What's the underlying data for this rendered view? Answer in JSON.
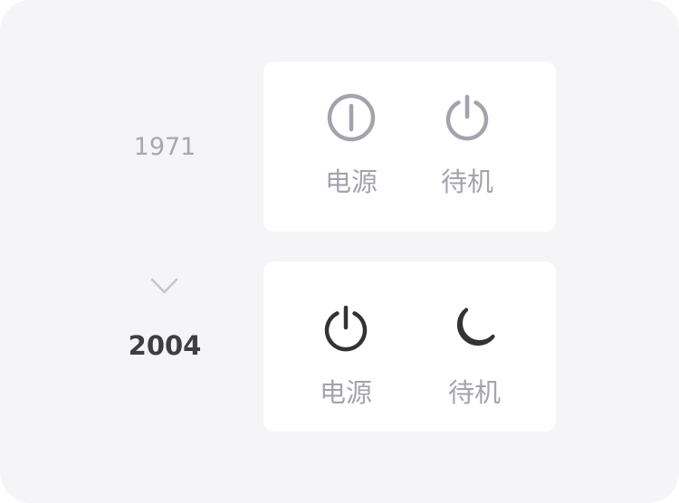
{
  "timeline": {
    "from_year": "1971",
    "to_year": "2004"
  },
  "old_design": {
    "power_label": "电源",
    "standby_label": "待机",
    "icon_color": "#a3a3ae"
  },
  "new_design": {
    "power_label": "电源",
    "standby_label": "待机",
    "icon_color": "#333333"
  },
  "colors": {
    "background": "#f5f5f7",
    "card": "#ffffff",
    "label": "#a3a3ae",
    "arrow": "#c6c6cc"
  }
}
